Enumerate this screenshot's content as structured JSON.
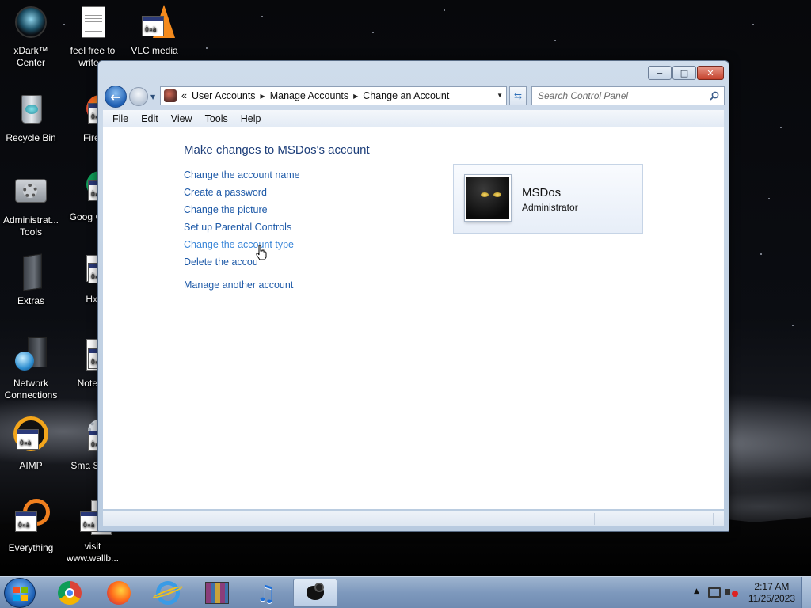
{
  "desktop": {
    "icons": [
      {
        "name": "xdark-center",
        "label": "xDark™ Center"
      },
      {
        "name": "feel-free",
        "label": "feel free to write a"
      },
      {
        "name": "vlc-media",
        "label": "VLC media"
      },
      {
        "name": "recycle-bin",
        "label": "Recycle Bin"
      },
      {
        "name": "firefox",
        "label": "Firef"
      },
      {
        "name": "admin-tools",
        "label": "Administrat... Tools"
      },
      {
        "name": "google-chrome",
        "label": "Goog Chro"
      },
      {
        "name": "extras",
        "label": "Extras"
      },
      {
        "name": "hxd",
        "label": "Hxl"
      },
      {
        "name": "network-connections",
        "label": "Network Connections"
      },
      {
        "name": "notepad",
        "label": "Notepa"
      },
      {
        "name": "aimp",
        "label": "AIMP"
      },
      {
        "name": "smart-services",
        "label": "Sma Servi"
      },
      {
        "name": "everything",
        "label": "Everything"
      },
      {
        "name": "visit-wallb",
        "label": "visit www.wallb..."
      }
    ]
  },
  "window": {
    "controls": {
      "minimize": "‒",
      "maximize": "□",
      "close": "✕"
    },
    "address": {
      "prefix": "«",
      "segments": [
        "User Accounts",
        "Manage Accounts",
        "Change an Account"
      ],
      "separator": "▶"
    },
    "search": {
      "placeholder": "Search Control Panel"
    },
    "menu": [
      "File",
      "Edit",
      "View",
      "Tools",
      "Help"
    ],
    "heading": "Make changes to MSDos's account",
    "tasks": [
      "Change the account name",
      "Create a password",
      "Change the picture",
      "Set up Parental Controls",
      "Change the account type",
      "Delete the accou"
    ],
    "manage_other": "Manage another account",
    "account": {
      "name": "MSDos",
      "type": "Administrator"
    }
  },
  "taskbar": {
    "clock_time": "2:17 AM",
    "clock_date": "11/25/2023"
  }
}
